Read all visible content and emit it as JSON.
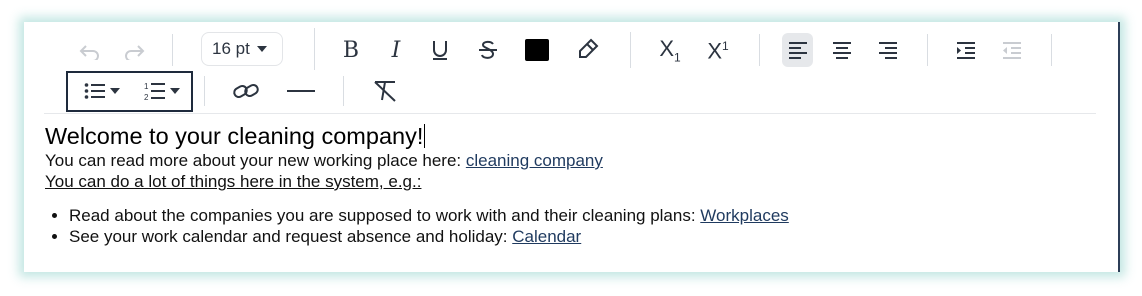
{
  "toolbar": {
    "font_size": "16 pt",
    "subscript_label": "X",
    "subscript_mark": "1",
    "superscript_label": "X",
    "superscript_mark": "1",
    "text_color": "#000000",
    "active_alignment": "left",
    "icons": [
      "undo-icon",
      "redo-icon",
      "bold-icon",
      "italic-icon",
      "underline-icon",
      "strikethrough-icon",
      "text-color-icon",
      "highlight-icon",
      "subscript-icon",
      "superscript-icon",
      "align-left-icon",
      "align-center-icon",
      "align-right-icon",
      "indent-icon",
      "outdent-icon",
      "bullet-list-icon",
      "numbered-list-icon",
      "link-icon",
      "horizontal-rule-icon",
      "clear-format-icon"
    ]
  },
  "content": {
    "heading": "Welcome to your cleaning company!",
    "intro_text": "You can read more about your new working place here: ",
    "intro_link": "cleaning company",
    "subheading": "You can do a lot of things here in the system, e.g.:",
    "items": [
      {
        "text": "Read about the companies you are supposed to work with and their cleaning plans: ",
        "link": "Workplaces"
      },
      {
        "text": "See your work calendar and request absence and holiday: ",
        "link": "Calendar"
      }
    ]
  }
}
